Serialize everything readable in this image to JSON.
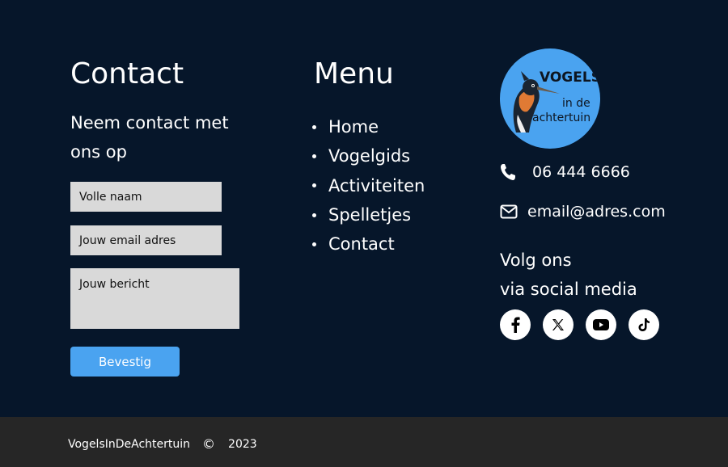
{
  "contact": {
    "title": "Contact",
    "subtitle": "Neem contact met ons op",
    "name_placeholder": "Volle naam",
    "email_placeholder": "Jouw email adres",
    "message_placeholder": "Jouw bericht",
    "submit_label": "Bevestig"
  },
  "menu": {
    "title": "Menu",
    "items": [
      "Home",
      "Vogelgids",
      "Activiteiten",
      "Spelletjes",
      "Contact"
    ]
  },
  "logo": {
    "line1": "VOGELS",
    "line2": "in de",
    "line3": "achtertuin"
  },
  "info": {
    "phone": "06 444 6666",
    "email": "email@adres.com",
    "follow_line1": "Volg ons",
    "follow_line2": "via social media"
  },
  "socials": [
    "facebook-icon",
    "x-icon",
    "youtube-icon",
    "tiktok-icon"
  ],
  "footer": {
    "brand": "VogelsInDeAchtertuin",
    "copyright_symbol": "©",
    "year": "2023"
  },
  "colors": {
    "background": "#06162a",
    "footer": "#262626",
    "accent": "#4aa3f0",
    "field": "#d9d9d9"
  }
}
